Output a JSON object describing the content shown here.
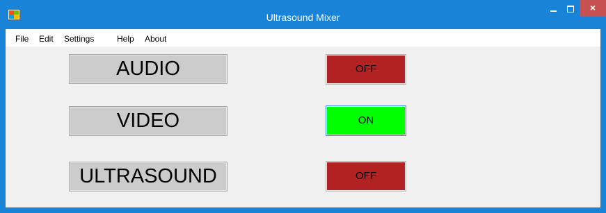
{
  "window": {
    "title": "Ultrasound Mixer",
    "minimize_icon": "minimize-icon",
    "maximize_icon": "maximize-icon",
    "close_label": "×"
  },
  "menu": {
    "items": [
      {
        "label": "File"
      },
      {
        "label": "Edit"
      },
      {
        "label": "Settings"
      },
      {
        "label": "Help"
      },
      {
        "label": "About"
      }
    ]
  },
  "channels": [
    {
      "label": "AUDIO",
      "state": "OFF",
      "color": "#b22222"
    },
    {
      "label": "VIDEO",
      "state": "ON",
      "color": "#00ff00"
    },
    {
      "label": "ULTRASOUND",
      "state": "OFF",
      "color": "#b22222"
    }
  ]
}
